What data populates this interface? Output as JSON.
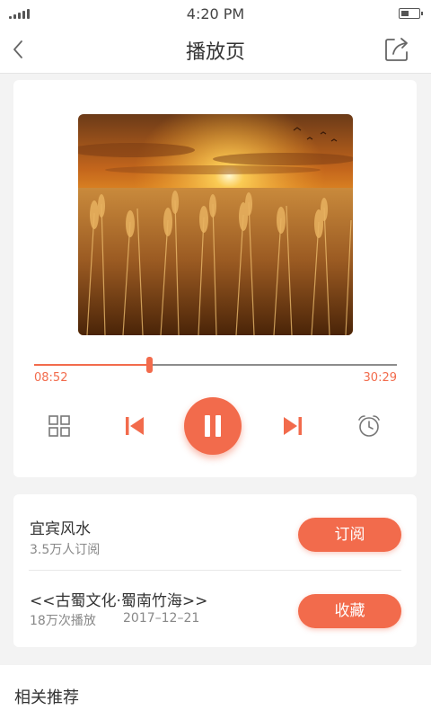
{
  "status_bar": {
    "time": "4:20 PM"
  },
  "nav": {
    "title": "播放页",
    "back_icon": "chevron-left-icon",
    "share_icon": "share-icon"
  },
  "player": {
    "cover_image": "wheat-field-sunset",
    "progress": {
      "current": "08:52",
      "total": "30:29",
      "fraction": 0.318
    },
    "controls": [
      "grid-icon",
      "previous-icon",
      "pause-icon",
      "next-icon",
      "alarm-clock-icon"
    ],
    "accent_color": "#f26b4c"
  },
  "info": {
    "program": {
      "title": "宜宾风水",
      "subscribers": "3.5万人订阅",
      "button": "订阅"
    },
    "episode": {
      "title": "<<古蜀文化·蜀南竹海>>",
      "plays": "18万次播放",
      "date": "2017–12–21",
      "button": "收藏"
    }
  },
  "recommend": {
    "title": "相关推荐"
  }
}
